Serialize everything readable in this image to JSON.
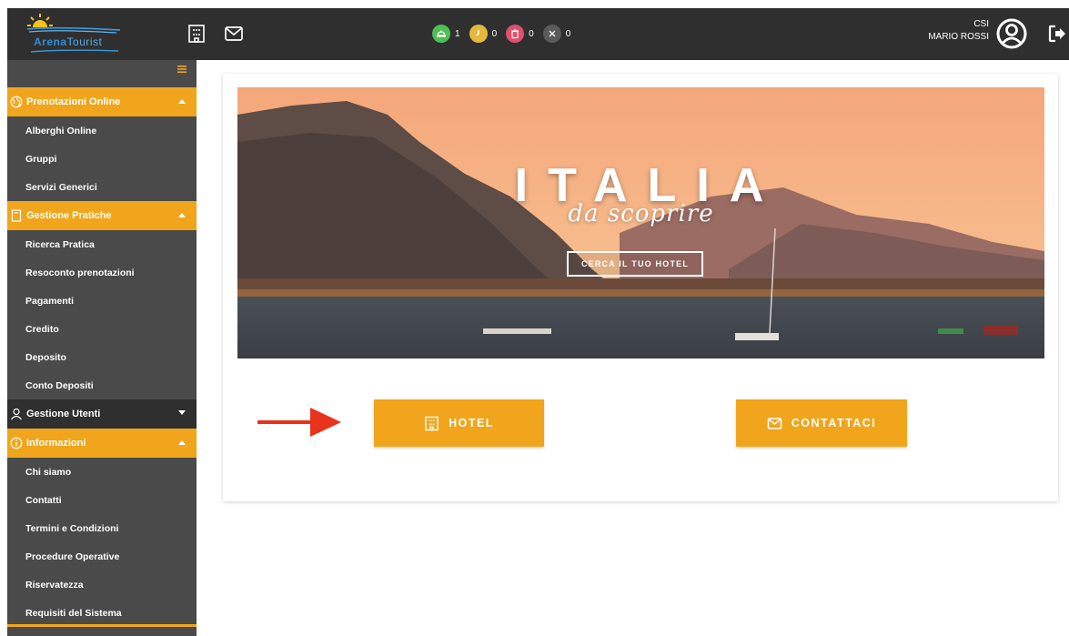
{
  "brand": {
    "logo_text_bold": "Arena",
    "logo_text_light": "Tourist"
  },
  "header": {
    "user_org": "CSI",
    "user_name": "MARIO ROSSI",
    "status": [
      {
        "name": "confirmed",
        "icon": "cloche-icon",
        "count": "1",
        "color": "#4fbf55"
      },
      {
        "name": "pending",
        "icon": "clock-icon",
        "count": "0",
        "color": "#e4b93a"
      },
      {
        "name": "deleted",
        "icon": "trash-icon",
        "count": "0",
        "color": "#e0506a"
      },
      {
        "name": "cancelled",
        "icon": "x-icon",
        "count": "0",
        "color": "#5a5a5a"
      }
    ]
  },
  "sidebar": {
    "sections": [
      {
        "label": "Prenotazioni Online",
        "style": "orange",
        "expanded": true,
        "items": [
          "Alberghi Online",
          "Gruppi",
          "Servizi Generici"
        ]
      },
      {
        "label": "Gestione Pratiche",
        "style": "orange",
        "expanded": true,
        "items": [
          "Ricerca Pratica",
          "Resoconto prenotazioni",
          "Pagamenti",
          "Credito",
          "Deposito",
          "Conto Depositi"
        ]
      },
      {
        "label": "Gestione Utenti",
        "style": "dark",
        "expanded": false,
        "items": []
      },
      {
        "label": "Informazioni",
        "style": "orange",
        "expanded": true,
        "items": [
          "Chi siamo",
          "Contatti",
          "Termini e Condizioni",
          "Procedure Operative",
          "Riservatezza",
          "Requisiti del Sistema"
        ]
      }
    ]
  },
  "banner": {
    "title": "ITALIA",
    "subtitle": "da scoprire",
    "cta": "CERCA IL TUO HOTEL"
  },
  "buttons": {
    "hotel": "HOTEL",
    "contact": "CONTATTACI"
  },
  "colors": {
    "accent": "#f0a51c",
    "header_bg": "#2f2f2f",
    "sidebar_bg": "#4a4a4a",
    "annotation_arrow": "#e8321c"
  }
}
